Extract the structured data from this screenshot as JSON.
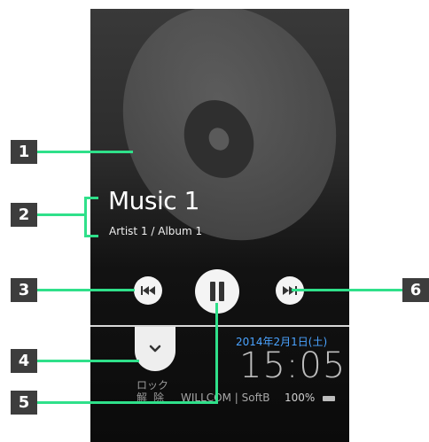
{
  "player": {
    "title": "Music 1",
    "subtitle": "Artist 1 / Album 1"
  },
  "controls": {
    "prev_icon": "skip-previous-icon",
    "pause_icon": "pause-icon",
    "next_icon": "skip-next-icon"
  },
  "lockscreen": {
    "unlock_label_line1": "ロック",
    "unlock_label_line2": "解除",
    "date": "2014年2月1日(土)",
    "time": "15:05",
    "carrier": "WILLCOM | SoftB",
    "battery": "100%"
  },
  "callouts": [
    "1",
    "2",
    "3",
    "4",
    "5",
    "6"
  ],
  "colors": {
    "callout_line": "#2fe08a",
    "callout_box": "#3d3d3d",
    "date_blue": "#4aa3ff"
  }
}
